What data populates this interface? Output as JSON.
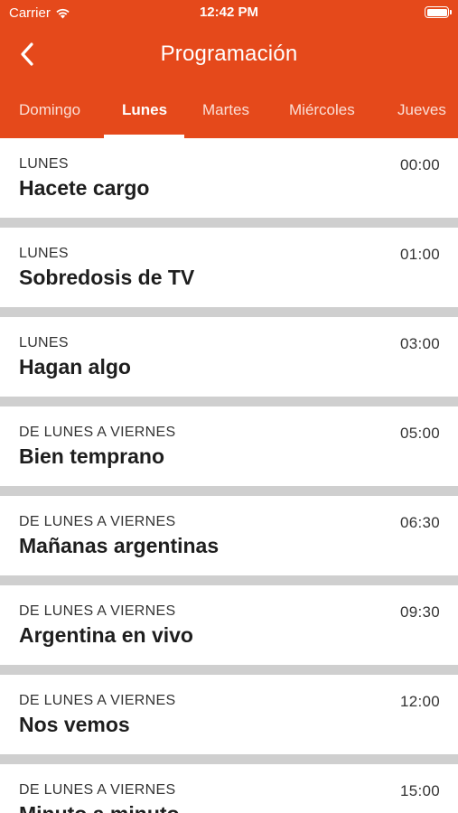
{
  "status_bar": {
    "carrier": "Carrier",
    "time": "12:42 PM"
  },
  "nav": {
    "title": "Programación",
    "back_icon": "chevron-left-icon"
  },
  "tabs": [
    {
      "label": "Domingo",
      "active": false
    },
    {
      "label": "Lunes",
      "active": true
    },
    {
      "label": "Martes",
      "active": false
    },
    {
      "label": "Miércoles",
      "active": false
    },
    {
      "label": "Jueves",
      "active": false
    }
  ],
  "programs": [
    {
      "day": "LUNES",
      "time": "00:00",
      "title": "Hacete cargo"
    },
    {
      "day": "LUNES",
      "time": "01:00",
      "title": "Sobredosis de TV"
    },
    {
      "day": "LUNES",
      "time": "03:00",
      "title": "Hagan algo"
    },
    {
      "day": "DE LUNES A VIERNES",
      "time": "05:00",
      "title": "Bien temprano"
    },
    {
      "day": "DE LUNES A VIERNES",
      "time": "06:30",
      "title": "Mañanas argentinas"
    },
    {
      "day": "DE LUNES A VIERNES",
      "time": "09:30",
      "title": "Argentina en vivo"
    },
    {
      "day": "DE LUNES A VIERNES",
      "time": "12:00",
      "title": "Nos vemos"
    },
    {
      "day": "DE LUNES A VIERNES",
      "time": "15:00",
      "title": "Minuto a minuto"
    }
  ],
  "colors": {
    "header_bg": "#e5491b",
    "separator": "#cfcfcf"
  }
}
